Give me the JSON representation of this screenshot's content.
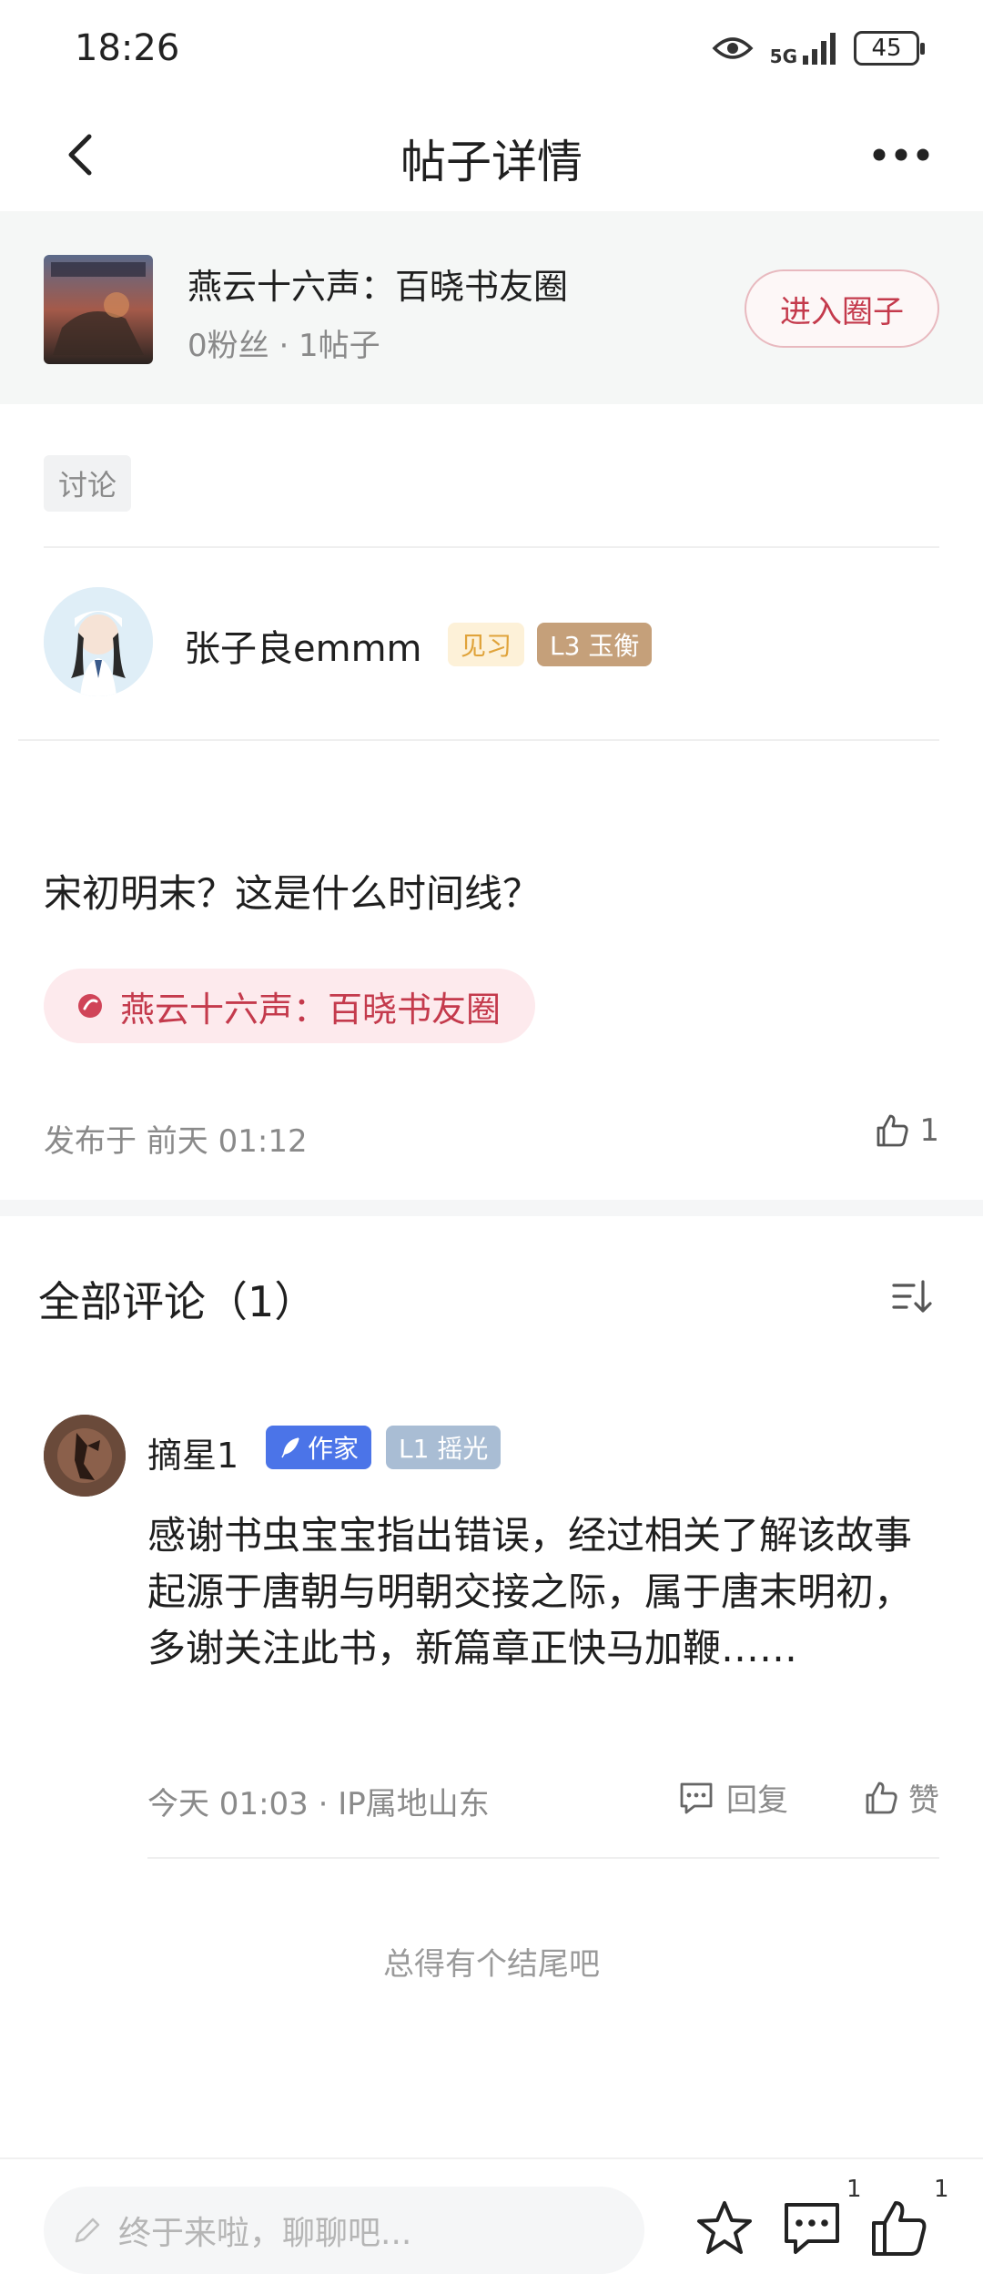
{
  "status_bar": {
    "time": "18:26",
    "network": "5G",
    "battery": "45"
  },
  "nav": {
    "title": "帖子详情",
    "back_icon": "chevron-left-icon",
    "more_icon": "more-dots-icon"
  },
  "circle": {
    "name": "燕云十六声：百晓书友圈",
    "stats": "0粉丝 · 1帖子",
    "enter_label": "进入圈子"
  },
  "post": {
    "tag": "讨论",
    "author": {
      "name": "张子良emmm",
      "badge_trainee": "见习",
      "badge_level": "L3 玉衡"
    },
    "text": "宋初明末？这是什么时间线？",
    "circle_tag": "燕云十六声：百晓书友圈",
    "publish_time": "发布于 前天 01:12",
    "like_count": "1"
  },
  "comments": {
    "title": "全部评论（1）",
    "items": [
      {
        "name": "摘星1",
        "badge_writer": "作家",
        "badge_level": "L1 摇光",
        "text": "感谢书虫宝宝指出错误，经过相关了解该故事起源于唐朝与明朝交接之际，属于唐末明初，多谢关注此书，新篇章正快马加鞭……",
        "meta": "今天 01:03 · IP属地山东",
        "reply_label": "回复",
        "like_label": "赞"
      }
    ],
    "end_text": "总得有个结尾吧"
  },
  "bottom_bar": {
    "input_placeholder": "终于来啦，聊聊吧...",
    "comment_count": "1",
    "like_count": "1"
  },
  "colors": {
    "accent_red": "#c43a4c",
    "writer_badge": "#4b74e8",
    "level_badge": "#c5a07a"
  }
}
